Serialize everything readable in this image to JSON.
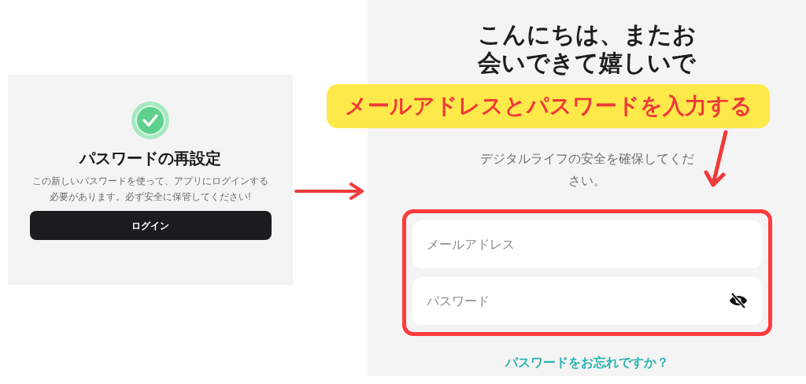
{
  "left_screen": {
    "title": "パスワードの再設定",
    "message": "この新しいパスワードを使って、アプリにログインする必要があります。必ず安全に保管してください!",
    "button": "ログイン"
  },
  "right_screen": {
    "heading": "こんにちは、またお会いできて嬉しいで",
    "subtitle": "デジタルライフの安全を確保してください。",
    "fields": [
      {
        "kind": "email",
        "placeholder": "メールアドレス"
      },
      {
        "kind": "password",
        "placeholder": "パスワード"
      }
    ],
    "forgot_link": "パスワードをお忘れですか？"
  },
  "annotation": {
    "callout": "メールアドレスとパスワードを入力する"
  }
}
